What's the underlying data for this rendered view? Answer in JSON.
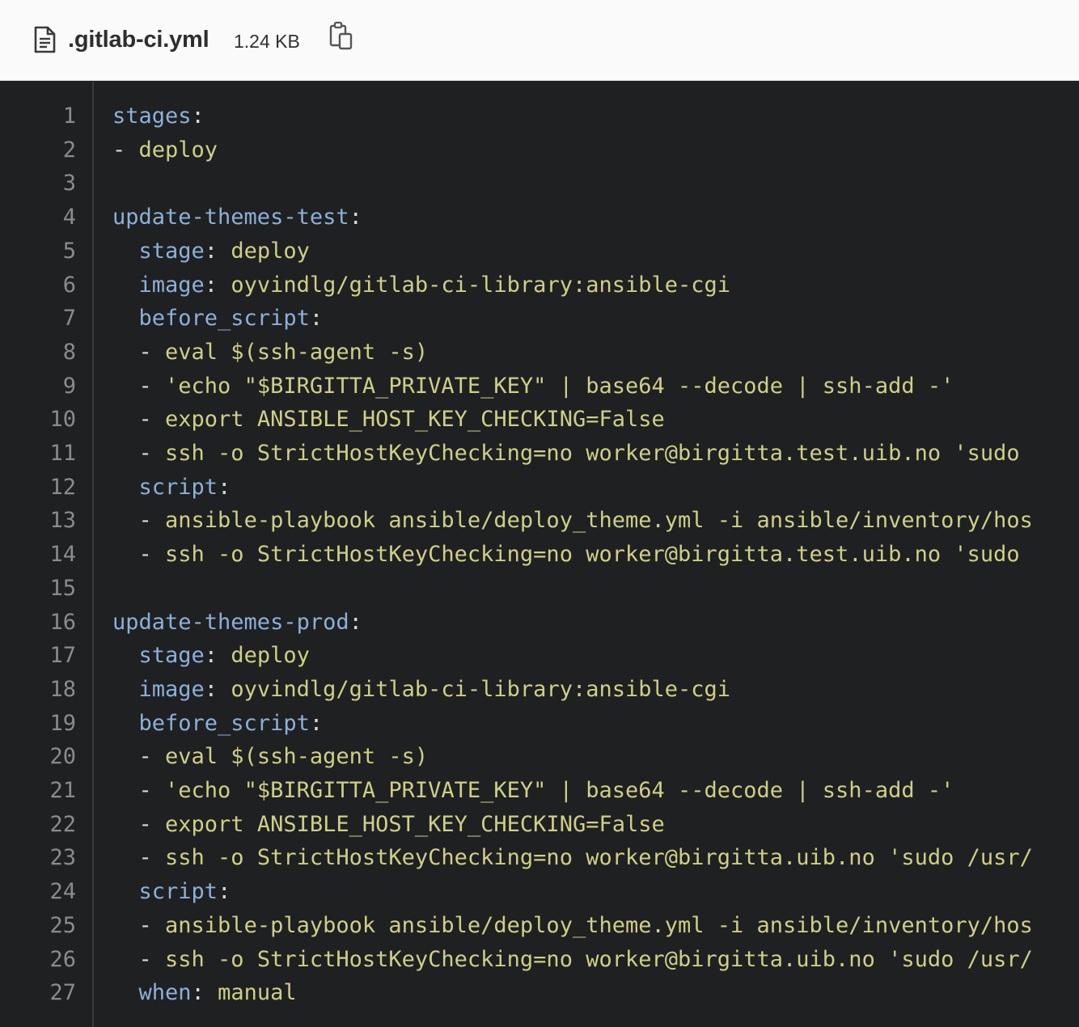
{
  "header": {
    "file_icon": "document-icon",
    "file_name": ".gitlab-ci.yml",
    "file_size": "1.24 KB",
    "copy_icon": "clipboard-copy-icon"
  },
  "code": {
    "lines": [
      {
        "num": "1",
        "tokens": [
          {
            "t": "key",
            "v": "stages"
          },
          {
            "t": "punc",
            "v": ":"
          }
        ]
      },
      {
        "num": "2",
        "tokens": [
          {
            "t": "punc",
            "v": "- "
          },
          {
            "t": "val",
            "v": "deploy"
          }
        ]
      },
      {
        "num": "3",
        "tokens": []
      },
      {
        "num": "4",
        "tokens": [
          {
            "t": "key",
            "v": "update-themes-test"
          },
          {
            "t": "punc",
            "v": ":"
          }
        ]
      },
      {
        "num": "5",
        "tokens": [
          {
            "t": "punc",
            "v": "  "
          },
          {
            "t": "key",
            "v": "stage"
          },
          {
            "t": "punc",
            "v": ": "
          },
          {
            "t": "val",
            "v": "deploy"
          }
        ]
      },
      {
        "num": "6",
        "tokens": [
          {
            "t": "punc",
            "v": "  "
          },
          {
            "t": "key",
            "v": "image"
          },
          {
            "t": "punc",
            "v": ": "
          },
          {
            "t": "val",
            "v": "oyvindlg/gitlab-ci-library:ansible-cgi"
          }
        ]
      },
      {
        "num": "7",
        "tokens": [
          {
            "t": "punc",
            "v": "  "
          },
          {
            "t": "key",
            "v": "before_script"
          },
          {
            "t": "punc",
            "v": ":"
          }
        ]
      },
      {
        "num": "8",
        "tokens": [
          {
            "t": "punc",
            "v": "  - "
          },
          {
            "t": "val",
            "v": "eval $(ssh-agent -s)"
          }
        ]
      },
      {
        "num": "9",
        "tokens": [
          {
            "t": "punc",
            "v": "  - "
          },
          {
            "t": "val",
            "v": "'echo \"$BIRGITTA_PRIVATE_KEY\" | base64 --decode | ssh-add -'"
          }
        ]
      },
      {
        "num": "10",
        "tokens": [
          {
            "t": "punc",
            "v": "  - "
          },
          {
            "t": "val",
            "v": "export ANSIBLE_HOST_KEY_CHECKING=False"
          }
        ]
      },
      {
        "num": "11",
        "tokens": [
          {
            "t": "punc",
            "v": "  - "
          },
          {
            "t": "val",
            "v": "ssh -o StrictHostKeyChecking=no worker@birgitta.test.uib.no 'sudo"
          }
        ]
      },
      {
        "num": "12",
        "tokens": [
          {
            "t": "punc",
            "v": "  "
          },
          {
            "t": "key",
            "v": "script"
          },
          {
            "t": "punc",
            "v": ":"
          }
        ]
      },
      {
        "num": "13",
        "tokens": [
          {
            "t": "punc",
            "v": "  - "
          },
          {
            "t": "val",
            "v": "ansible-playbook ansible/deploy_theme.yml -i ansible/inventory/hos"
          }
        ]
      },
      {
        "num": "14",
        "tokens": [
          {
            "t": "punc",
            "v": "  - "
          },
          {
            "t": "val",
            "v": "ssh -o StrictHostKeyChecking=no worker@birgitta.test.uib.no 'sudo"
          }
        ]
      },
      {
        "num": "15",
        "tokens": []
      },
      {
        "num": "16",
        "tokens": [
          {
            "t": "key",
            "v": "update-themes-prod"
          },
          {
            "t": "punc",
            "v": ":"
          }
        ]
      },
      {
        "num": "17",
        "tokens": [
          {
            "t": "punc",
            "v": "  "
          },
          {
            "t": "key",
            "v": "stage"
          },
          {
            "t": "punc",
            "v": ": "
          },
          {
            "t": "val",
            "v": "deploy"
          }
        ]
      },
      {
        "num": "18",
        "tokens": [
          {
            "t": "punc",
            "v": "  "
          },
          {
            "t": "key",
            "v": "image"
          },
          {
            "t": "punc",
            "v": ": "
          },
          {
            "t": "val",
            "v": "oyvindlg/gitlab-ci-library:ansible-cgi"
          }
        ]
      },
      {
        "num": "19",
        "tokens": [
          {
            "t": "punc",
            "v": "  "
          },
          {
            "t": "key",
            "v": "before_script"
          },
          {
            "t": "punc",
            "v": ":"
          }
        ]
      },
      {
        "num": "20",
        "tokens": [
          {
            "t": "punc",
            "v": "  - "
          },
          {
            "t": "val",
            "v": "eval $(ssh-agent -s)"
          }
        ]
      },
      {
        "num": "21",
        "tokens": [
          {
            "t": "punc",
            "v": "  - "
          },
          {
            "t": "val",
            "v": "'echo \"$BIRGITTA_PRIVATE_KEY\" | base64 --decode | ssh-add -'"
          }
        ]
      },
      {
        "num": "22",
        "tokens": [
          {
            "t": "punc",
            "v": "  - "
          },
          {
            "t": "val",
            "v": "export ANSIBLE_HOST_KEY_CHECKING=False"
          }
        ]
      },
      {
        "num": "23",
        "tokens": [
          {
            "t": "punc",
            "v": "  - "
          },
          {
            "t": "val",
            "v": "ssh -o StrictHostKeyChecking=no worker@birgitta.uib.no 'sudo /usr/"
          }
        ]
      },
      {
        "num": "24",
        "tokens": [
          {
            "t": "punc",
            "v": "  "
          },
          {
            "t": "key",
            "v": "script"
          },
          {
            "t": "punc",
            "v": ":"
          }
        ]
      },
      {
        "num": "25",
        "tokens": [
          {
            "t": "punc",
            "v": "  - "
          },
          {
            "t": "val",
            "v": "ansible-playbook ansible/deploy_theme.yml -i ansible/inventory/hos"
          }
        ]
      },
      {
        "num": "26",
        "tokens": [
          {
            "t": "punc",
            "v": "  - "
          },
          {
            "t": "val",
            "v": "ssh -o StrictHostKeyChecking=no worker@birgitta.uib.no 'sudo /usr/"
          }
        ]
      },
      {
        "num": "27",
        "tokens": [
          {
            "t": "punc",
            "v": "  "
          },
          {
            "t": "key",
            "v": "when"
          },
          {
            "t": "punc",
            "v": ": "
          },
          {
            "t": "val",
            "v": "manual"
          }
        ]
      }
    ]
  },
  "colors": {
    "code_background": "#1f2022",
    "line_number": "#8a8b8d",
    "yaml_key": "#8cb0d8",
    "yaml_value": "#cfcf86",
    "punctuation": "#d8d8d8",
    "header_background": "#fafafa"
  }
}
